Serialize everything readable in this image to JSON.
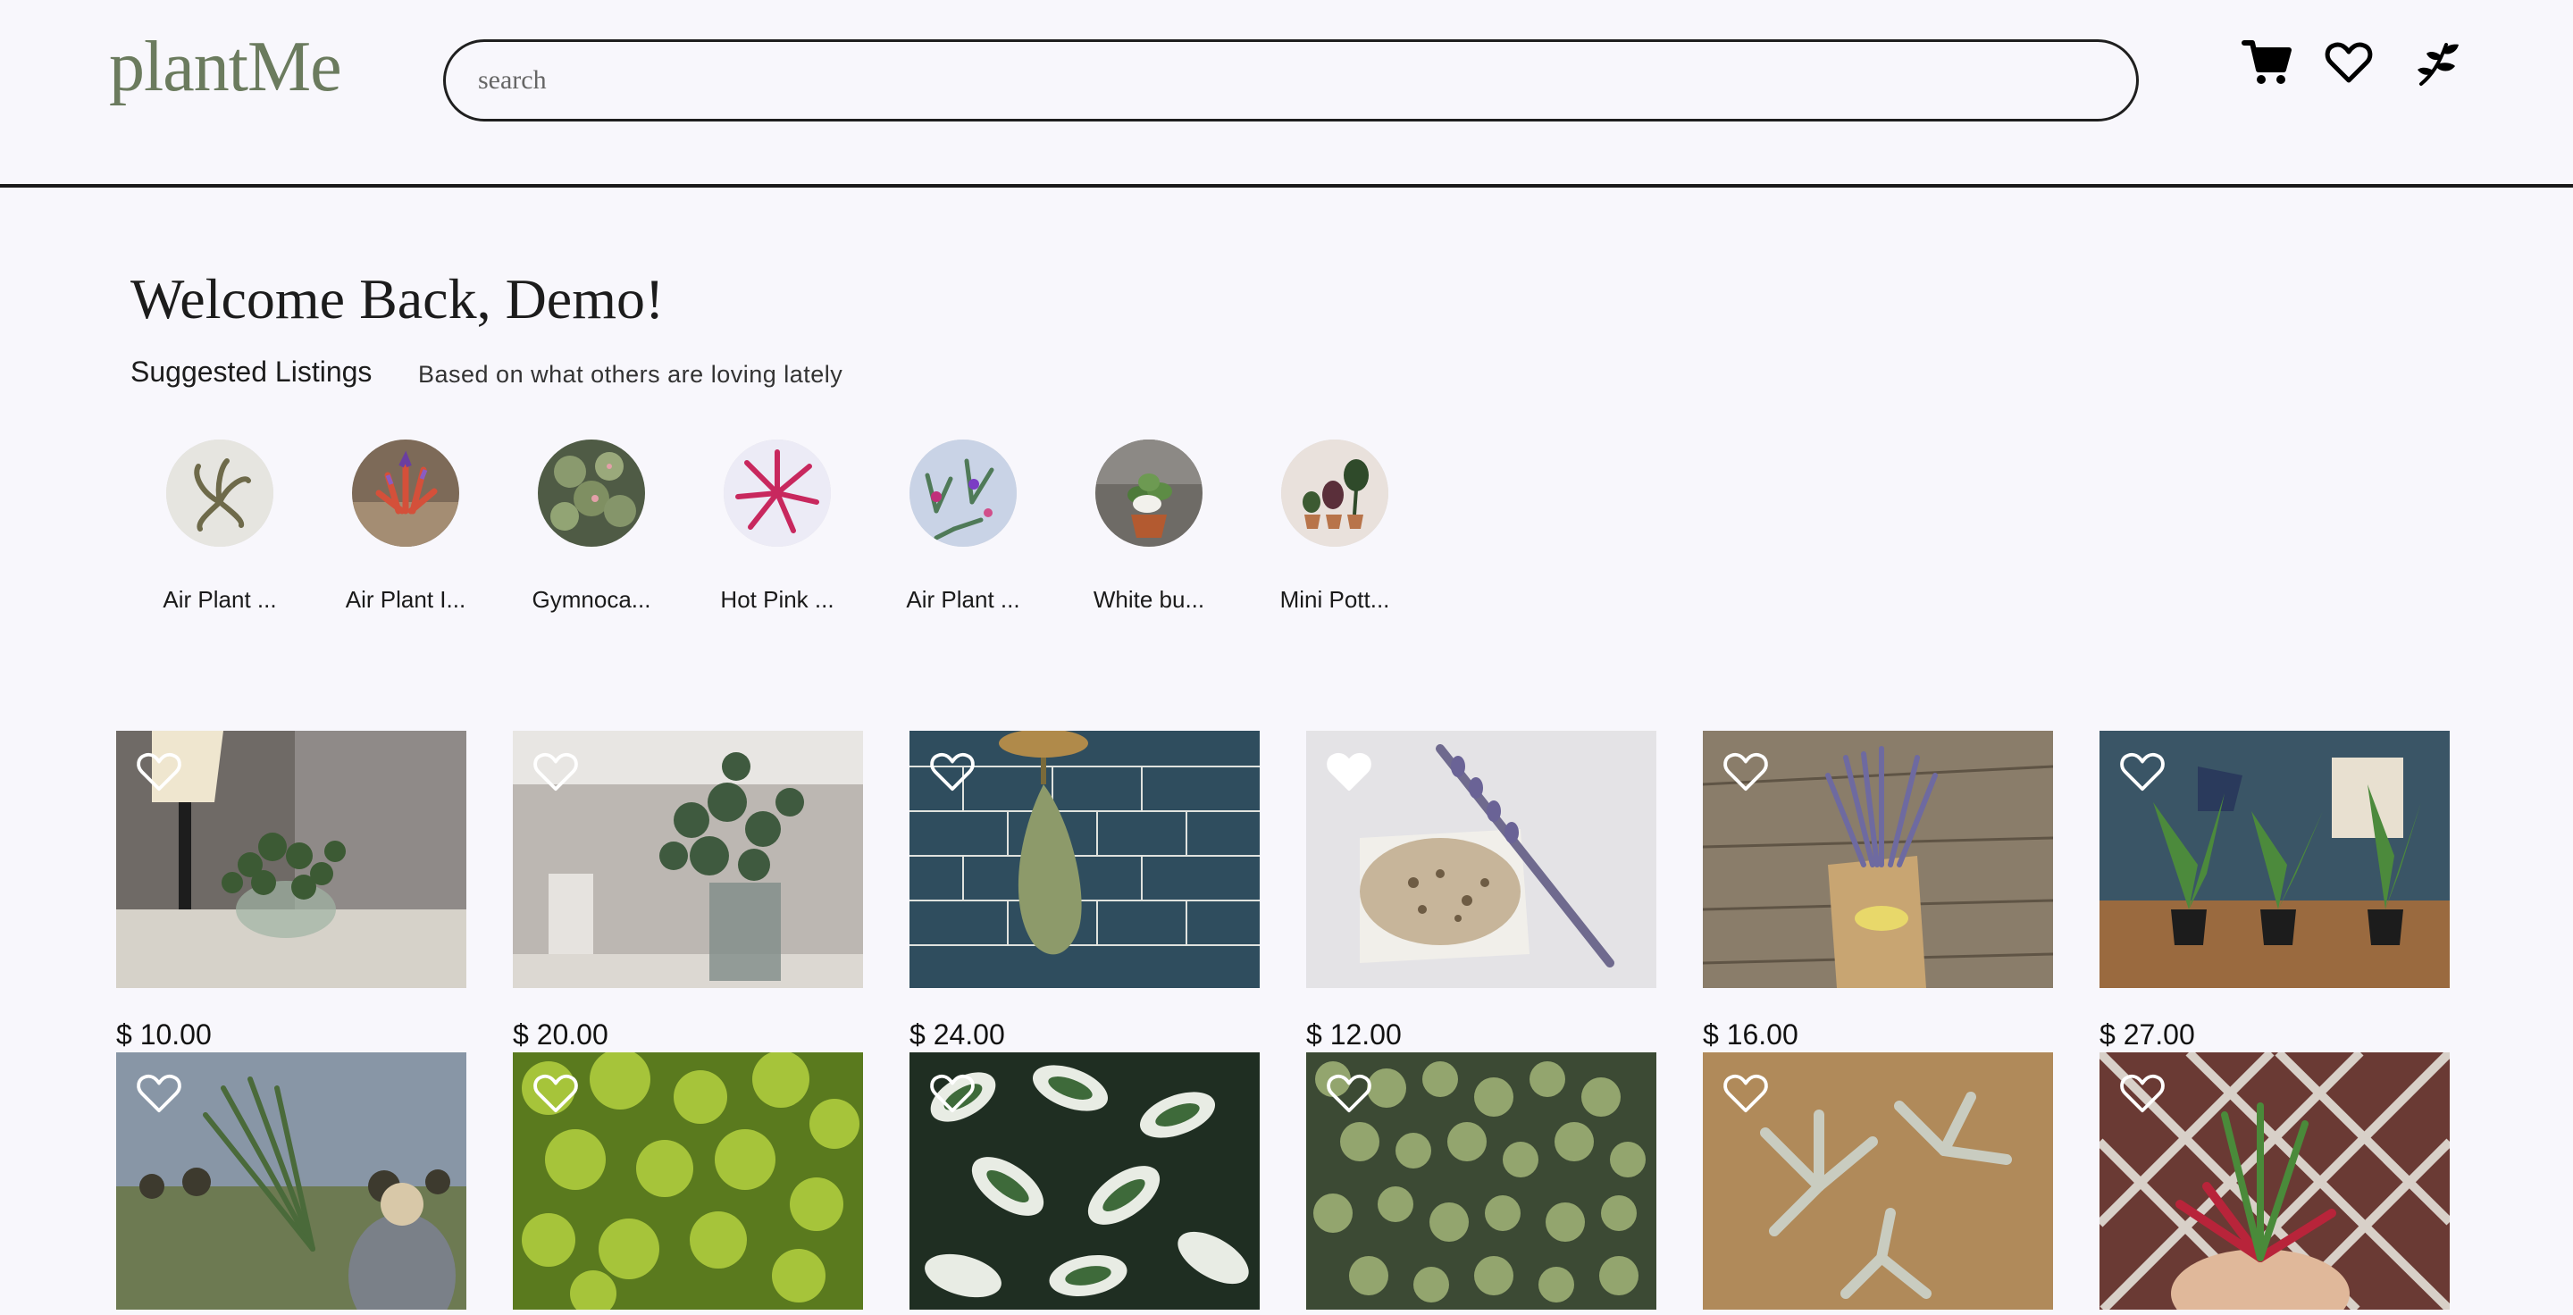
{
  "header": {
    "logo": "plantMe",
    "search_placeholder": "search",
    "icons": [
      "cart-icon",
      "heart-icon",
      "plant-sprout-icon"
    ]
  },
  "welcome": {
    "title": "Welcome Back, Demo!",
    "suggested_title": "Suggested Listings",
    "suggested_subtitle": "Based on what others are loving lately"
  },
  "suggestions": [
    {
      "label": "Air Plant ..."
    },
    {
      "label": "Air Plant I..."
    },
    {
      "label": "Gymnoca..."
    },
    {
      "label": "Hot Pink ..."
    },
    {
      "label": "Air Plant ..."
    },
    {
      "label": "White bu..."
    },
    {
      "label": "Mini Pott..."
    }
  ],
  "listings": [
    {
      "price": "$ 10.00"
    },
    {
      "price": "$ 20.00"
    },
    {
      "price": "$ 24.00"
    },
    {
      "price": "$ 12.00"
    },
    {
      "price": "$ 16.00"
    },
    {
      "price": "$ 27.00"
    },
    {
      "price": ""
    },
    {
      "price": ""
    },
    {
      "price": ""
    },
    {
      "price": ""
    },
    {
      "price": ""
    },
    {
      "price": ""
    }
  ],
  "colors": {
    "background": "#f8f7fc",
    "logo": "#6b7b5e",
    "text": "#1a1a1a"
  }
}
